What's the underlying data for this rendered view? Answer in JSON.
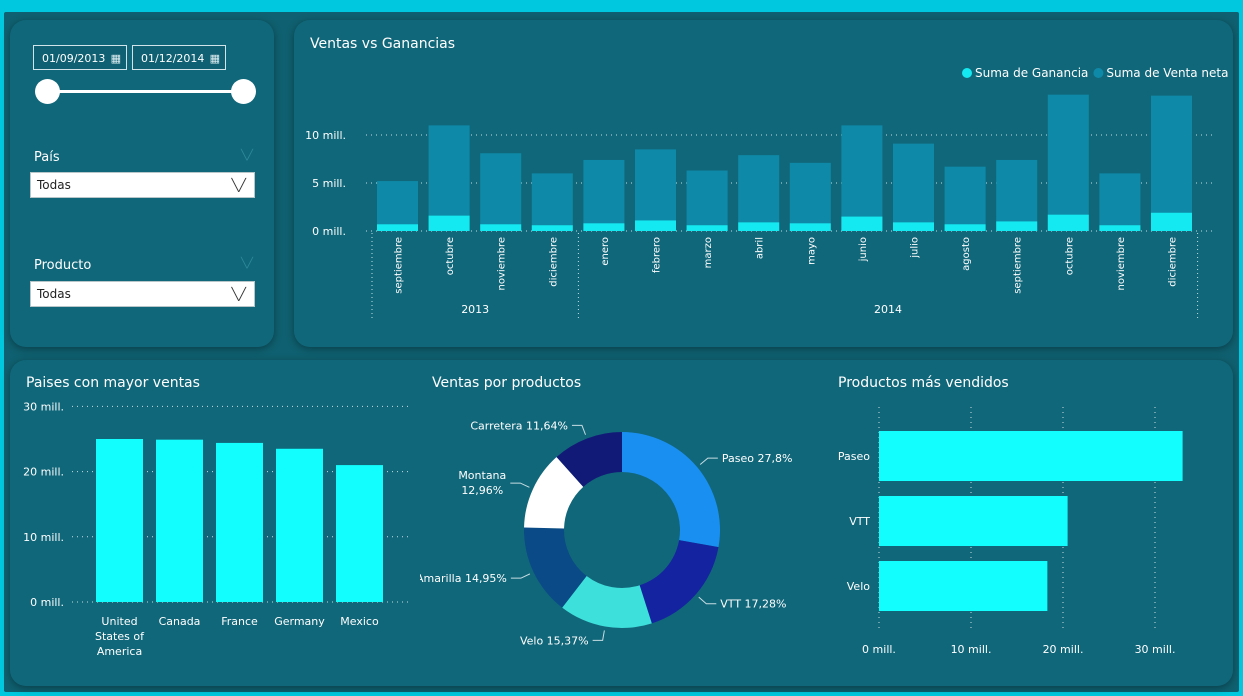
{
  "filters": {
    "date_start": "01/09/2013",
    "date_end": "01/12/2014",
    "country_label": "País",
    "country_value": "Todas",
    "product_label": "Producto",
    "product_value": "Todas"
  },
  "chart_data": [
    {
      "id": "sales_vs_profit",
      "type": "bar",
      "title": "Ventas vs Ganancias",
      "categories": [
        "septiembre",
        "octubre",
        "noviembre",
        "diciembre",
        "enero",
        "febrero",
        "marzo",
        "abril",
        "mayo",
        "junio",
        "julio",
        "agosto",
        "septiembre",
        "octubre",
        "noviembre",
        "diciembre"
      ],
      "year_groups": [
        {
          "label": "2013",
          "count": 4
        },
        {
          "label": "2014",
          "count": 12
        }
      ],
      "series": [
        {
          "name": "Suma de Ganancia",
          "color": "#14e8f0",
          "values": [
            0.7,
            1.6,
            0.7,
            0.6,
            0.8,
            1.1,
            0.6,
            0.9,
            0.8,
            1.5,
            0.9,
            0.7,
            1.0,
            1.7,
            0.6,
            1.9
          ]
        },
        {
          "name": "Suma de Venta neta",
          "color": "#0e8aa8",
          "values": [
            5.2,
            11.0,
            8.1,
            6.0,
            7.4,
            8.5,
            6.3,
            7.9,
            7.1,
            11.0,
            9.1,
            6.7,
            7.4,
            14.2,
            6.0,
            14.1
          ]
        }
      ],
      "y_ticks": [
        "10 mill.",
        "5 mill.",
        "0 mill."
      ],
      "y_tick_values": [
        10,
        5,
        0
      ],
      "ylim": [
        0,
        15
      ],
      "legend": "top-right",
      "grid": true
    },
    {
      "id": "top_countries",
      "type": "bar",
      "title": "Paises con mayor ventas",
      "categories": [
        "United States of America",
        "Canada",
        "France",
        "Germany",
        "Mexico"
      ],
      "category_lines": [
        [
          "United",
          "States of",
          "America"
        ],
        [
          "Canada"
        ],
        [
          "France"
        ],
        [
          "Germany"
        ],
        [
          "Mexico"
        ]
      ],
      "values": [
        25.0,
        24.9,
        24.4,
        23.5,
        21.0
      ],
      "color": "#12fdfd",
      "y_ticks": [
        "30 mill.",
        "20 mill.",
        "10 mill.",
        "0 mill."
      ],
      "y_tick_values": [
        30,
        20,
        10,
        0
      ],
      "ylim": [
        0,
        30
      ],
      "grid": true
    },
    {
      "id": "sales_by_product",
      "type": "pie",
      "title": "Ventas por productos",
      "slices": [
        {
          "label": "Paseo",
          "percent": 27.8,
          "display": "Paseo 27,8%",
          "color": "#1a8ff2"
        },
        {
          "label": "VTT",
          "percent": 17.28,
          "display": "VTT 17,28%",
          "color": "#1423a0"
        },
        {
          "label": "Velo",
          "percent": 15.37,
          "display": "Velo 15,37%",
          "color": "#3ee0dc"
        },
        {
          "label": "Amarilla",
          "percent": 14.95,
          "display": "Amarilla 14,95%",
          "color": "#0a4a86"
        },
        {
          "label": "Montana",
          "percent": 12.96,
          "display_lines": [
            "Montana",
            "12,96%"
          ],
          "color": "#ffffff"
        },
        {
          "label": "Carretera",
          "percent": 11.64,
          "display": "Carretera 11,64%",
          "color": "#121a78"
        }
      ]
    },
    {
      "id": "top_products",
      "type": "bar",
      "orientation": "horizontal",
      "title": "Productos más vendidos",
      "categories": [
        "Paseo",
        "VTT",
        "Velo"
      ],
      "values": [
        33.0,
        20.5,
        18.3
      ],
      "color": "#12fdfd",
      "x_ticks": [
        "0 mill.",
        "10 mill.",
        "20 mill.",
        "30 mill."
      ],
      "x_tick_values": [
        0,
        10,
        20,
        30
      ],
      "xlim": [
        0,
        36
      ],
      "grid": true
    }
  ]
}
